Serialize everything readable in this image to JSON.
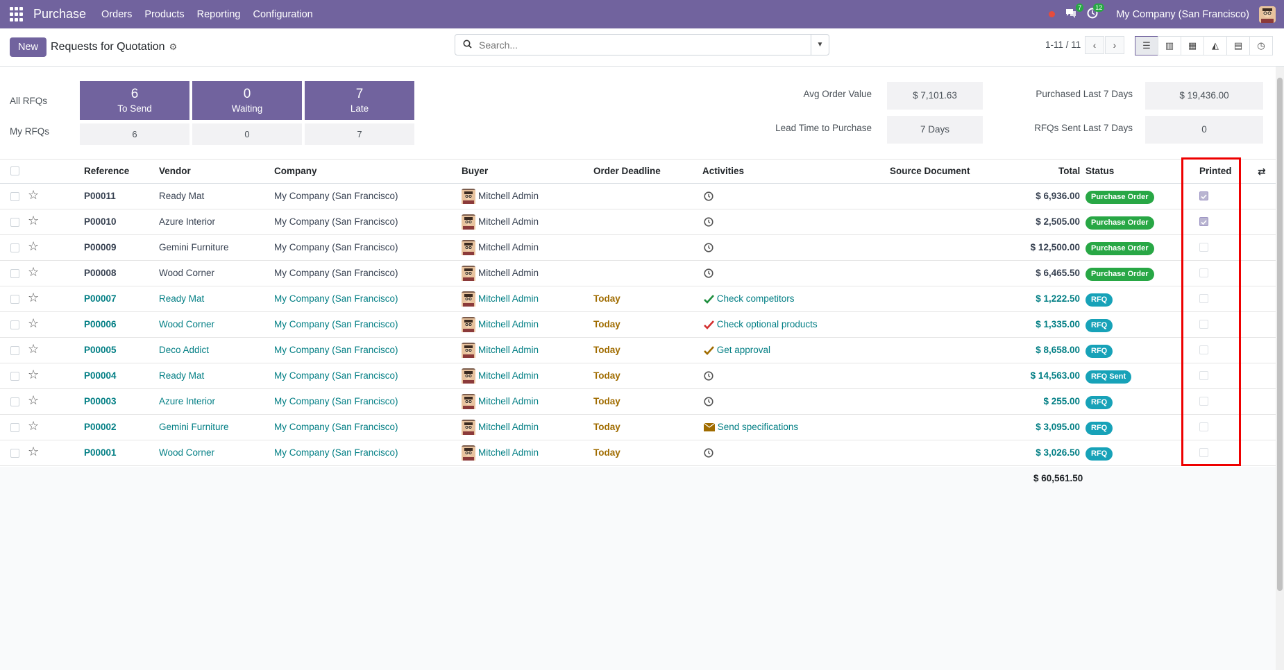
{
  "nav": {
    "brand": "Purchase",
    "menu": [
      "Orders",
      "Products",
      "Reporting",
      "Configuration"
    ],
    "chat_count": "7",
    "activity_count": "12",
    "company": "My Company (San Francisco)"
  },
  "control": {
    "new_label": "New",
    "title": "Requests for Quotation",
    "search_placeholder": "Search...",
    "pager": "1-11 / 11"
  },
  "dashboard": {
    "all_rfqs": "All RFQs",
    "my_rfqs": "My RFQs",
    "tiles": [
      {
        "n": "6",
        "l": "To Send",
        "mine": "6"
      },
      {
        "n": "0",
        "l": "Waiting",
        "mine": "0"
      },
      {
        "n": "7",
        "l": "Late",
        "mine": "7"
      }
    ],
    "kpis": [
      {
        "label": "Avg Order Value",
        "value": "$ 7,101.63"
      },
      {
        "label": "Lead Time to Purchase",
        "value": "7 Days"
      },
      {
        "label": "Purchased Last 7 Days",
        "value": "$ 19,436.00"
      },
      {
        "label": "RFQs Sent Last 7 Days",
        "value": "0"
      }
    ]
  },
  "table": {
    "headers": {
      "reference": "Reference",
      "vendor": "Vendor",
      "company": "Company",
      "buyer": "Buyer",
      "deadline": "Order Deadline",
      "activities": "Activities",
      "source": "Source Document",
      "total": "Total",
      "status": "Status",
      "printed": "Printed"
    },
    "rows": [
      {
        "ref": "P00011",
        "vendor": "Ready Mat",
        "company": "My Company (San Francisco)",
        "buyer": "Mitchell Admin",
        "deadline": "",
        "activity": "",
        "activity_icon": "clock-icon",
        "total": "$ 6,936.00",
        "status": "Purchase Order",
        "printed": true
      },
      {
        "ref": "P00010",
        "vendor": "Azure Interior",
        "company": "My Company (San Francisco)",
        "buyer": "Mitchell Admin",
        "deadline": "",
        "activity": "",
        "activity_icon": "clock-icon",
        "total": "$ 2,505.00",
        "status": "Purchase Order",
        "printed": true
      },
      {
        "ref": "P00009",
        "vendor": "Gemini Furniture",
        "company": "My Company (San Francisco)",
        "buyer": "Mitchell Admin",
        "deadline": "",
        "activity": "",
        "activity_icon": "clock-icon",
        "total": "$ 12,500.00",
        "status": "Purchase Order",
        "printed": false
      },
      {
        "ref": "P00008",
        "vendor": "Wood Corner",
        "company": "My Company (San Francisco)",
        "buyer": "Mitchell Admin",
        "deadline": "",
        "activity": "",
        "activity_icon": "clock-icon",
        "total": "$ 6,465.50",
        "status": "Purchase Order",
        "printed": false
      },
      {
        "ref": "P00007",
        "vendor": "Ready Mat",
        "company": "My Company (San Francisco)",
        "buyer": "Mitchell Admin",
        "deadline": "Today",
        "activity": "Check competitors",
        "activity_icon": "check-green-icon",
        "total": "$ 1,222.50",
        "status": "RFQ",
        "printed": false
      },
      {
        "ref": "P00006",
        "vendor": "Wood Corner",
        "company": "My Company (San Francisco)",
        "buyer": "Mitchell Admin",
        "deadline": "Today",
        "activity": "Check optional products",
        "activity_icon": "check-red-icon",
        "total": "$ 1,335.00",
        "status": "RFQ",
        "printed": false
      },
      {
        "ref": "P00005",
        "vendor": "Deco Addict",
        "company": "My Company (San Francisco)",
        "buyer": "Mitchell Admin",
        "deadline": "Today",
        "activity": "Get approval",
        "activity_icon": "check-orange-icon",
        "total": "$ 8,658.00",
        "status": "RFQ",
        "printed": false
      },
      {
        "ref": "P00004",
        "vendor": "Ready Mat",
        "company": "My Company (San Francisco)",
        "buyer": "Mitchell Admin",
        "deadline": "Today",
        "activity": "",
        "activity_icon": "clock-icon",
        "total": "$ 14,563.00",
        "status": "RFQ Sent",
        "printed": false
      },
      {
        "ref": "P00003",
        "vendor": "Azure Interior",
        "company": "My Company (San Francisco)",
        "buyer": "Mitchell Admin",
        "deadline": "Today",
        "activity": "",
        "activity_icon": "clock-icon",
        "total": "$ 255.00",
        "status": "RFQ",
        "printed": false
      },
      {
        "ref": "P00002",
        "vendor": "Gemini Furniture",
        "company": "My Company (San Francisco)",
        "buyer": "Mitchell Admin",
        "deadline": "Today",
        "activity": "Send specifications",
        "activity_icon": "envelope-icon",
        "total": "$ 3,095.00",
        "status": "RFQ",
        "printed": false
      },
      {
        "ref": "P00001",
        "vendor": "Wood Corner",
        "company": "My Company (San Francisco)",
        "buyer": "Mitchell Admin",
        "deadline": "Today",
        "activity": "",
        "activity_icon": "clock-icon",
        "total": "$ 3,026.50",
        "status": "RFQ",
        "printed": false
      }
    ],
    "grand_total": "$ 60,561.50"
  },
  "colors": {
    "brand": "#71639e",
    "link": "#017e84",
    "po": "#28a745",
    "rfq": "#17a2b8",
    "highlight": "#ee0000"
  }
}
